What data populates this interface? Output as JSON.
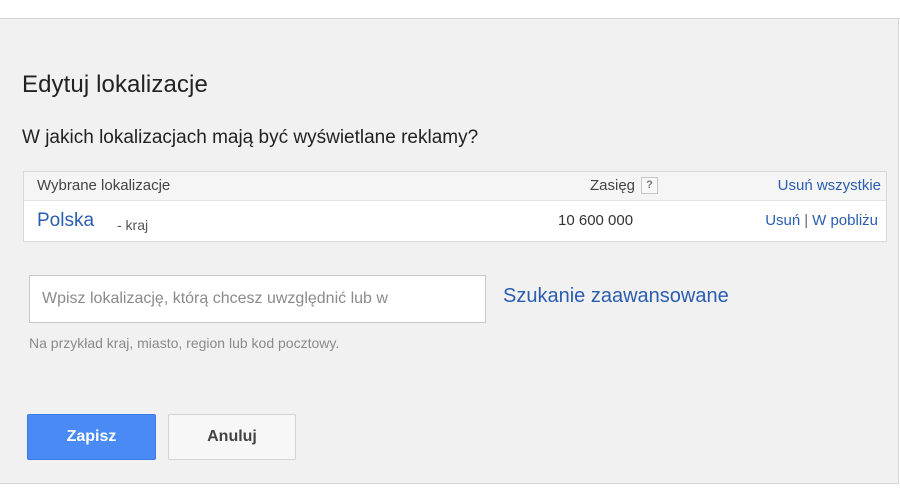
{
  "dialog": {
    "title": "Edytuj lokalizacje",
    "question": "W jakich lokalizacjach mają być wyświetlane reklamy?"
  },
  "locations_table": {
    "header": {
      "selected_label": "Wybrane lokalizacje",
      "reach_label": "Zasięg",
      "help_icon_text": "?",
      "remove_all": "Usuń wszystkie"
    },
    "rows": [
      {
        "name": "Polska",
        "type": "- kraj",
        "reach": "10 600 000",
        "remove": "Usuń",
        "separator": "|",
        "nearby": "W pobliżu"
      }
    ]
  },
  "search": {
    "placeholder": "Wpisz lokalizację, którą chcesz uwzględnić lub w",
    "value": "",
    "advanced_link": "Szukanie zaawansowane",
    "hint": "Na przykład kraj, miasto, region lub kod pocztowy."
  },
  "buttons": {
    "save": "Zapisz",
    "cancel": "Anuluj"
  },
  "colors": {
    "link": "#2a5db0",
    "primary_button": "#4a8af4",
    "panel_background": "#f1f1f1"
  }
}
